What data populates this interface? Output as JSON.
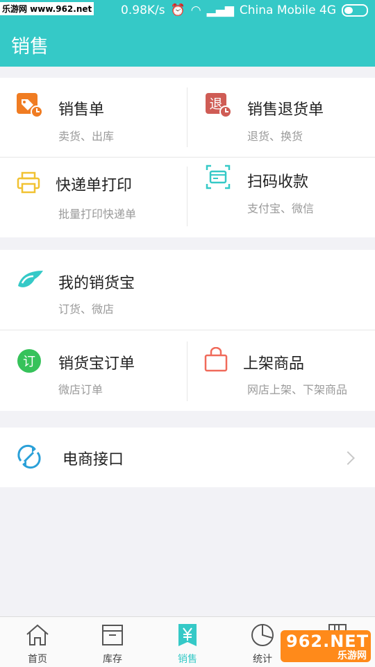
{
  "statusbar": {
    "watermark": "乐游网 www.962.net",
    "speed": "0.98K/s",
    "carrier": "China Mobile 4G"
  },
  "header": {
    "title": "销售"
  },
  "sections": {
    "top": [
      {
        "label": "销售单",
        "sub": "卖货、出库",
        "icon": "price-tag-icon",
        "color": "#f07c22"
      },
      {
        "label": "销售退货单",
        "sub": "退货、换货",
        "icon": "return-icon",
        "color": "#cf5c55"
      },
      {
        "label": "快递单打印",
        "sub": "批量打印快递单",
        "icon": "printer-icon",
        "color": "#f1c232"
      },
      {
        "label": "扫码收款",
        "sub": "支付宝、微信",
        "icon": "card-scan-icon",
        "color": "#35c9c7"
      }
    ],
    "middle": [
      {
        "label": "我的销货宝",
        "sub": "订货、微店",
        "icon": "bird-icon",
        "color": "#35c9c7"
      },
      {
        "label": "销货宝订单",
        "sub": "微店订单",
        "icon": "order-icon",
        "color": "#36c25a"
      },
      {
        "label": "上架商品",
        "sub": "网店上架、下架商品",
        "icon": "shopping-bag-icon",
        "color": "#f06a5a"
      }
    ],
    "bottom": {
      "label": "电商接口",
      "icon": "sync-icon",
      "color": "#2aa0d8"
    }
  },
  "tabbar": [
    {
      "label": "首页",
      "icon": "home-icon"
    },
    {
      "label": "库存",
      "icon": "box-icon"
    },
    {
      "label": "销售",
      "icon": "yen-icon",
      "active": true
    },
    {
      "label": "统计",
      "icon": "pie-chart-icon"
    },
    {
      "label": "",
      "icon": "book-icon"
    }
  ],
  "watermark_bottom": {
    "line1": "962.NET",
    "line2": "乐游网"
  }
}
